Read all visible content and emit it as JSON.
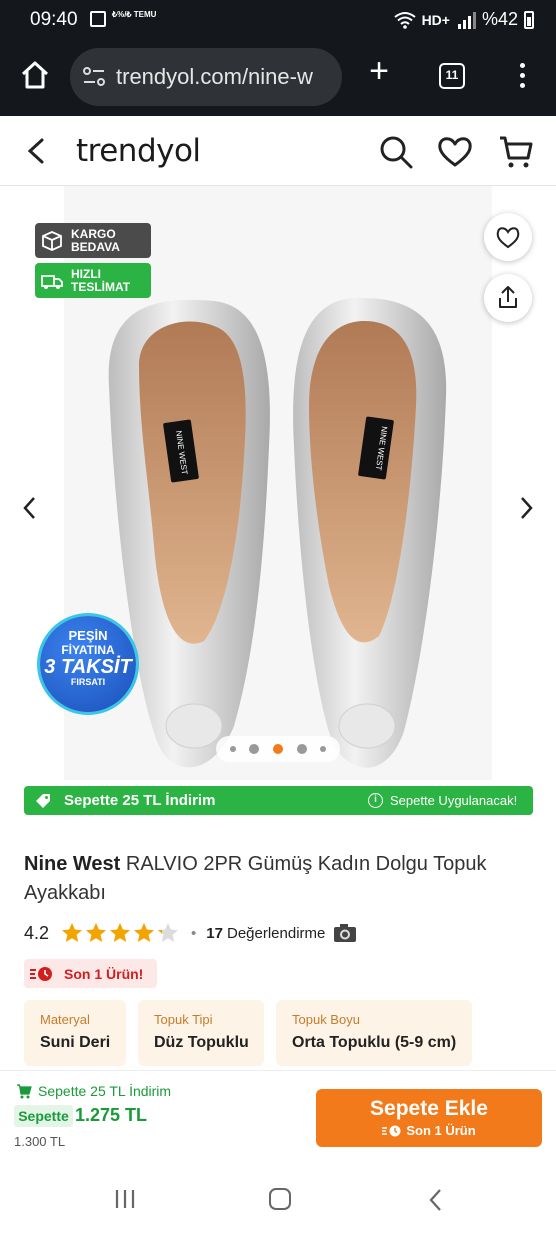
{
  "status_bar": {
    "time": "09:40",
    "notif_temu": "₺%/₺ TEMU",
    "right_text": "%42",
    "icons": [
      "gallery-icon",
      "wifi-icon",
      "hd-icon",
      "signal-icon",
      "battery-icon"
    ]
  },
  "browser": {
    "url": "trendyol.com/nine-w",
    "tab_count": "11",
    "icons": [
      "home-icon",
      "site-settings-icon",
      "new-tab-icon",
      "tabs-icon",
      "menu-icon"
    ]
  },
  "header": {
    "logo": "trendyol",
    "icons": [
      "back-icon",
      "search-icon",
      "favorites-icon",
      "cart-icon"
    ]
  },
  "gallery": {
    "badges": {
      "cargo": "KARGO BEDAVA",
      "fast": "HIZLI TESLİMAT"
    },
    "taksit": {
      "line1": "PEŞİN",
      "line2": "FİYATINA",
      "line3": "3 TAKSİT",
      "line4": "FIRSATI"
    },
    "current_image": 3,
    "image_count": 5,
    "promo_left": "Sepette 25 TL İndirim",
    "promo_right": "Sepette Uygulanacak!",
    "promo_info": "i"
  },
  "product": {
    "brand": "Nine West",
    "name": " RALVIO 2PR Gümüş Kadın Dolgu Topuk Ayakkabı",
    "rating": "4.2",
    "rating_value": 4.2,
    "rating_sep": "•",
    "review_count": "17",
    "review_label": "Değerlendirme",
    "last_items": "Son 1 Ürün!",
    "attributes": [
      {
        "key": "Materyal",
        "value": "Suni Deri"
      },
      {
        "key": "Topuk Tipi",
        "value": "Düz Topuklu"
      },
      {
        "key": "Topuk Boyu",
        "value": "Orta Topuklu (5-9 cm)"
      }
    ]
  },
  "buy_bar": {
    "discount_text": "Sepette 25 TL İndirim",
    "sepette_label": "Sepette",
    "price": "1.275 TL",
    "old_price": "1.300 TL",
    "add_button": "Sepete Ekle",
    "add_button_sub": "Son 1 Ürün"
  },
  "colors": {
    "brand_orange": "#f27a1a",
    "promo_green": "#2bb344",
    "price_green": "#1a9b3a",
    "urgent_red": "#d21e1e",
    "attr_bg": "#fdf3e6"
  }
}
